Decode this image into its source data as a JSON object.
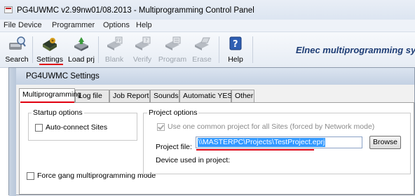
{
  "window": {
    "title": "PG4UWMC v2.99nw01/08.2013 - Multiprogramming Control Panel"
  },
  "menu": {
    "items": [
      "File",
      "Device",
      "Programmer",
      "Options",
      "Help"
    ]
  },
  "toolbar": {
    "buttons": [
      {
        "label": "Search",
        "icon": "search-programmer-icon",
        "enabled": true
      },
      {
        "label": "Settings",
        "icon": "settings-chip-icon",
        "enabled": true
      },
      {
        "label": "Load prj",
        "icon": "load-project-icon",
        "enabled": true
      },
      {
        "label": "Blank",
        "icon": "blank-check-icon",
        "enabled": false
      },
      {
        "label": "Verify",
        "icon": "verify-icon",
        "enabled": false
      },
      {
        "label": "Program",
        "icon": "program-icon",
        "enabled": false
      },
      {
        "label": "Erase",
        "icon": "erase-icon",
        "enabled": false
      },
      {
        "label": "Help",
        "icon": "help-icon",
        "enabled": true
      }
    ],
    "brand": "Elnec multiprogramming syste"
  },
  "dialog": {
    "title": "PG4UWMC Settings",
    "tabs": [
      "Multiprogramming",
      "Log file",
      "Job Report",
      "Sounds",
      "Automatic YES!",
      "Other"
    ],
    "active_tab": "Multiprogramming",
    "startup_options": {
      "label": "Startup options",
      "auto_connect": {
        "label": "Auto-connect Sites",
        "checked": false
      }
    },
    "force_gang": {
      "label": "Force gang multiprogramming mode",
      "checked": false
    },
    "project_options": {
      "label": "Project options",
      "use_common": {
        "label": "Use one common project for all Sites (forced by Network mode)",
        "checked": true,
        "enabled": false
      },
      "project_file_label": "Project file:",
      "project_file_value": "\\\\MASTERPC\\Projects\\TestProject.eprj",
      "browse_label": "Browse",
      "device_used_label": "Device used in project:"
    }
  },
  "colors": {
    "highlight_underline": "#e0000f",
    "selection": "#3399ff",
    "brand_text": "#1d3c74"
  }
}
